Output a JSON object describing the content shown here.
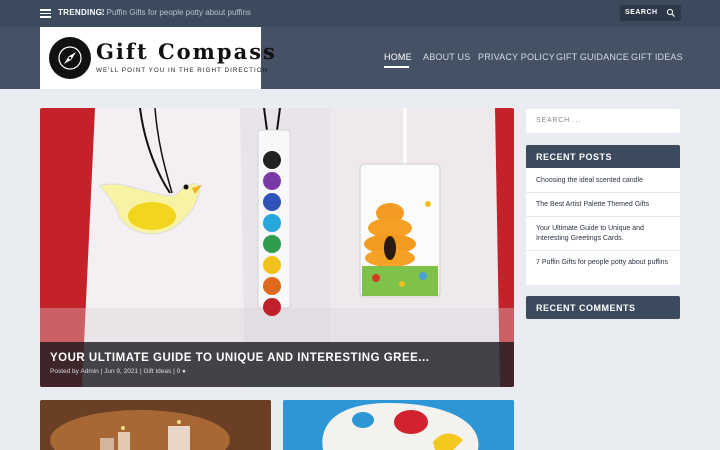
{
  "topbar": {
    "trending_label": "TRENDING:",
    "trending_text": "7 Puffin Gifts for people potty about puffins",
    "search_label": "SEARCH"
  },
  "header": {
    "logo_title": "Gift Compass",
    "logo_tagline": "WE'LL POINT YOU IN THE RIGHT DIRECTION",
    "nav": [
      "HOME",
      "ABOUT US",
      "PRIVACY POLICY",
      "GIFT GUIDANCE",
      "GIFT IDEAS"
    ],
    "active_nav": "HOME"
  },
  "featured": {
    "title": "YOUR ULTIMATE GUIDE TO UNIQUE AND INTERESTING GREE...",
    "meta_posted_by": "Posted by",
    "meta_author": "Admin",
    "meta_date": "Jun 9, 2021",
    "meta_category": "Gift Ideas",
    "meta_comments": "0"
  },
  "sidebar": {
    "search_placeholder": "SEARCH ...",
    "recent_posts_title": "RECENT POSTS",
    "recent_posts": [
      "Choosing the ideal scented candle",
      "The Best Artist Palette Themed Gifts",
      "Your Ultimate Guide to Unique and Interesting Greetings Cards.",
      "7 Puffin Gifts for people potty about puffins"
    ],
    "recent_comments_title": "RECENT COMMENTS"
  },
  "colors": {
    "topbar": "#3c4a5d",
    "header": "#455266",
    "background": "#e9ecf1",
    "featured_red": "#c4222a"
  }
}
